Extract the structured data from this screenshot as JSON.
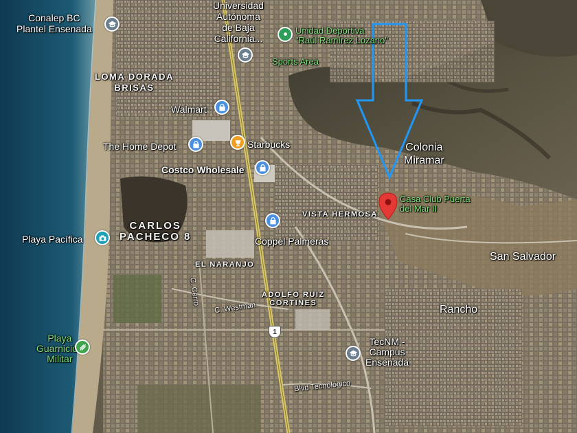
{
  "colors": {
    "ocean": "#1a4a63",
    "beach": "#b8a88a",
    "shopping_pin": "#4a8fe0",
    "education_pin": "#6b7f8f",
    "sports_pin": "#2e9d5a",
    "food_pin": "#f0a020",
    "attraction_pin": "#1fa0b5",
    "park_pin": "#3fa34d",
    "selected_pin": "#e53935",
    "arrow_outline": "#2196f3",
    "green_label": "#7fe07a"
  },
  "places": {
    "conalep": "Conalep BC\nPlantel Ensenada",
    "universidad": "Universidad\nAutónoma\nde Baja\nCalifornia...",
    "unidad_deportiva": "Unidad Deportiva\n\"Raúl Ramírez Lozano\"",
    "sports_area": "Sports Area",
    "walmart": "Walmart",
    "home_depot": "The Home Depot",
    "starbucks": "Starbucks",
    "costco": "Costco Wholesale",
    "coppel": "Coppel Palmeras",
    "casa_club": "Casa Club Puerta\ndel Mar II",
    "playa_pacifica": "Playa Pacífica",
    "playa_guarnicion": "Playa\nGuarnición\nMilitar",
    "tecnm": "TecNM -\nCampus\nEnsenada"
  },
  "neighborhoods": {
    "loma_dorada": "LOMA DORADA\nBRISAS",
    "carlos_pacheco": "CARLOS\nPACHECO 8",
    "vista_hermosa": "VISTA HERMOSA",
    "el_naranjo": "EL NARANJO",
    "adolfo_ruiz": "ADOLFO RUIZ\nCORTINES",
    "colonia_miramar": "Colonia\nMiramar",
    "san_salvador": "San Salvador",
    "rancho": "Rancho"
  },
  "streets": {
    "c_westman": "C. Westman",
    "c_cerro": "C. Cerro",
    "blvd_tecnologico": "Blvd Tecnológico"
  },
  "highway": {
    "number": "1"
  },
  "icons": {
    "conalep": "graduation-cap-icon",
    "universidad": "graduation-cap-icon",
    "unidad_deportiva": "location-pin-icon",
    "walmart": "shopping-bag-icon",
    "home_depot": "shopping-bag-icon",
    "starbucks": "coffee-cup-icon",
    "costco": "shopping-bag-icon",
    "coppel": "shopping-bag-icon",
    "casa_club": "red-map-marker-icon",
    "playa_pacifica": "camera-icon",
    "playa_guarnicion": "hiking-icon",
    "tecnm": "graduation-cap-icon",
    "annotation": "down-arrow-outline-icon"
  }
}
